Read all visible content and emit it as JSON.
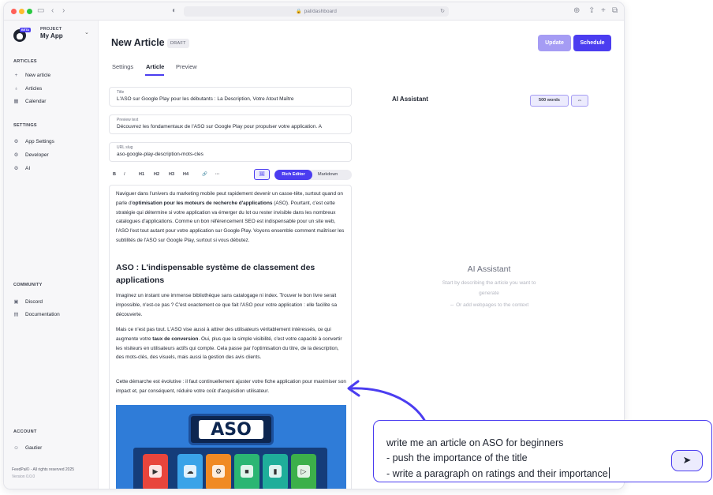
{
  "browser": {
    "url": "pal/dashboard"
  },
  "sidebar": {
    "beta_badge": "BETA",
    "project_label": "PROJECT",
    "project_name": "My App",
    "sections": {
      "articles": {
        "title": "ARTICLES",
        "items": [
          {
            "label": "New article",
            "icon": "plus-icon"
          },
          {
            "label": "Articles",
            "icon": "bulb-icon"
          },
          {
            "label": "Calendar",
            "icon": "calendar-icon"
          }
        ]
      },
      "settings": {
        "title": "SETTINGS",
        "items": [
          {
            "label": "App Settings",
            "icon": "gear-icon"
          },
          {
            "label": "Developer",
            "icon": "gear-icon"
          },
          {
            "label": "AI",
            "icon": "gear-icon"
          }
        ]
      },
      "community": {
        "title": "COMMUNITY",
        "items": [
          {
            "label": "Discord",
            "icon": "discord-icon"
          },
          {
            "label": "Documentation",
            "icon": "doc-icon"
          }
        ]
      },
      "account": {
        "title": "ACCOUNT",
        "items": [
          {
            "label": "Gautier",
            "icon": "user-icon"
          }
        ]
      }
    },
    "footer": {
      "copyright": "FeedPal© - All rights reserved 2025",
      "version": "Version 0.0.0"
    }
  },
  "header": {
    "title": "New Article",
    "status": "DRAFT",
    "update_label": "Update",
    "schedule_label": "Schedule"
  },
  "tabs": [
    {
      "label": "Settings",
      "active": false
    },
    {
      "label": "Article",
      "active": true
    },
    {
      "label": "Preview",
      "active": false
    }
  ],
  "form": {
    "title": {
      "label": "Title",
      "value": "L'ASO sur Google Play pour les débutants : La Description, Votre Atout Maître"
    },
    "preview": {
      "label": "Preview text",
      "value": "Découvrez les fondamentaux de l'ASO sur Google Play pour propulser votre application. A"
    },
    "slug": {
      "label": "URL slug",
      "value": "aso-google-play-description-mots-cles"
    }
  },
  "toolbar": {
    "bold": "B",
    "italic": "I",
    "h1": "H1",
    "h2": "H2",
    "h3": "H3",
    "h4": "H4",
    "link": "🔗",
    "more": "···",
    "image": "🖼",
    "rich_editor": "Rich Editor",
    "markdown": "Markdown"
  },
  "article": {
    "p1_a": "Naviguer dans l'univers du marketing mobile peut rapidement devenir un casse-tête, surtout quand on parle d'",
    "p1_b": "optimisation pour les moteurs de recherche d'applications",
    "p1_c": " (ASO). Pourtant, c'est cette stratégie qui détermine si votre application va émerger du lot ou rester invisible dans les nombreux catalogues d'applications. Comme un bon référencement SEO est indispensable pour un site web, l'ASO l'est tout autant pour votre application sur Google Play. Voyons ensemble comment maîtriser les subtilités de l'ASO sur Google Play, surtout si vous débutez.",
    "h2": "ASO : L'indispensable système de classement des applications",
    "p2": "Imaginez un instant une immense bibliothèque sans catalogage ni index. Trouver le bon livre serait impossible, n'est-ce pas ? C'est exactement ce que fait l'ASO pour votre application : elle facilite sa découverte.",
    "p3_a": "Mais ce n'est pas tout. L'ASO vise aussi à attirer des utilisateurs véritablement intéressés, ce qui augmente votre ",
    "p3_b": "taux de conversion",
    "p3_c": ". Oui, plus que la simple visibilité, c'est votre capacité à convertir les visiteurs en utilisateurs actifs qui compte. Cela passe par l'optimisation du titre, de la description, des mots-clés, des visuels, mais aussi la gestion des avis clients.",
    "p4": "Cette démarche est évolutive : il faut continuellement ajuster votre fiche application pour maximiser son impact et, par conséquent, réduire votre coût d'acquisition utilisateur.",
    "image_text": "ASO"
  },
  "assistant": {
    "title": "AI Assistant",
    "words_label": "500 words",
    "link_icon": "⇔",
    "center_title": "AI Assistant",
    "center_sub": "Start by describing the article you want to generate",
    "center_link": "⇔  Or add webpages to the context"
  },
  "prompt": {
    "lines": [
      "write me an article on ASO for beginners",
      "- push the importance of the title",
      "- write a paragraph on ratings and their importance"
    ],
    "send_icon": "➤"
  },
  "colors": {
    "accent": "#4b3df0",
    "accent_light": "#a59cf4"
  }
}
